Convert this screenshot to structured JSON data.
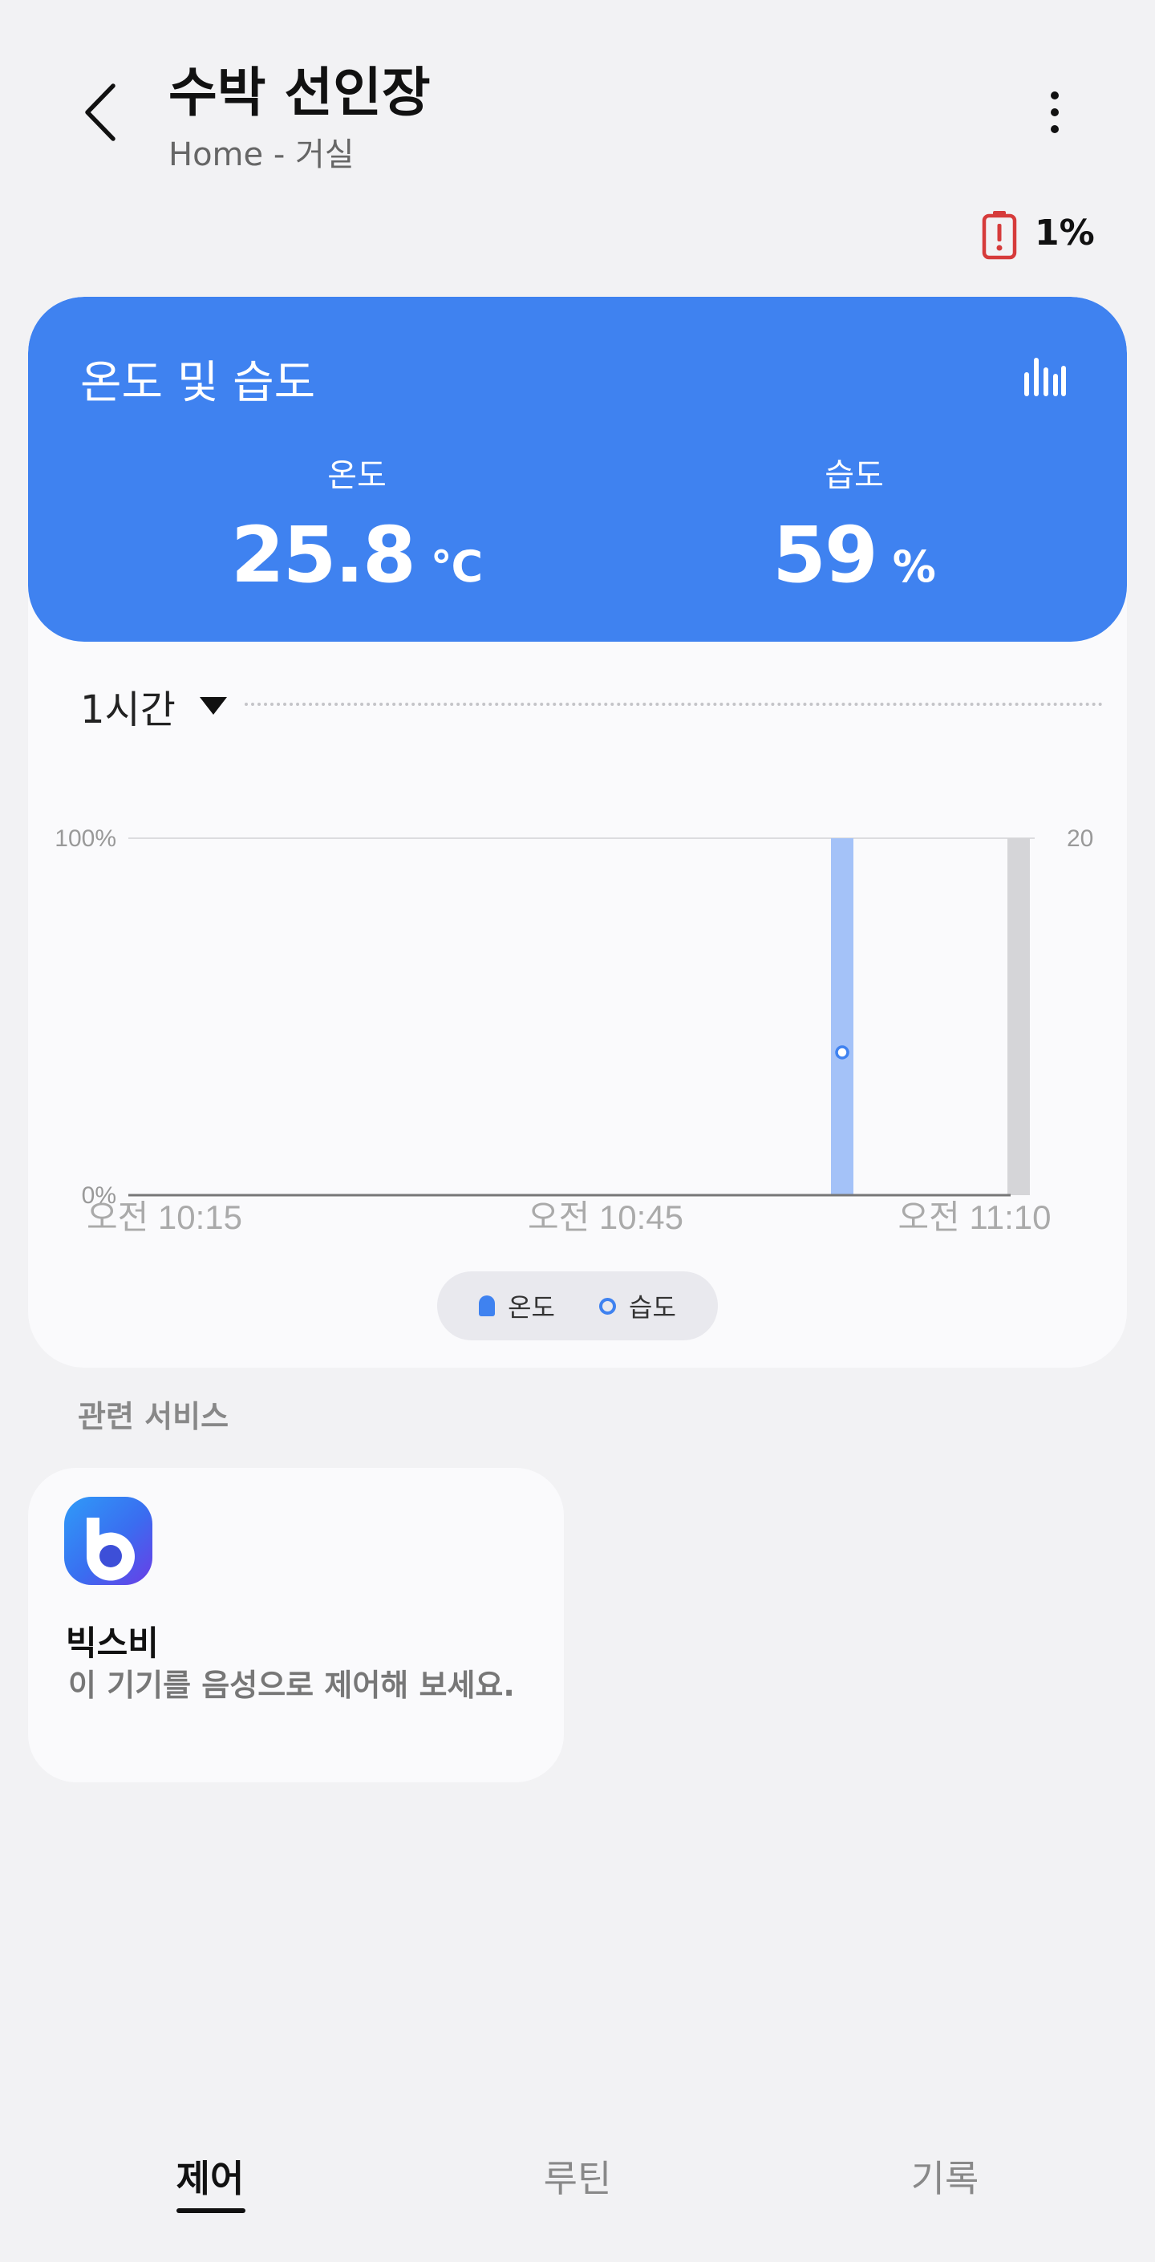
{
  "header": {
    "title": "수박 선인장",
    "subtitle": "Home - 거실",
    "battery": "1%"
  },
  "card": {
    "title": "온도 및 습도",
    "temperature": {
      "label": "온도",
      "value": "25.8",
      "unit": "℃"
    },
    "humidity": {
      "label": "습도",
      "value": "59",
      "unit": "%"
    },
    "range": "1시간"
  },
  "chart_data": {
    "type": "bar",
    "x_ticks": [
      "오전 10:15",
      "오전 10:45",
      "오전 11:10"
    ],
    "left_axis": {
      "ticks": [
        "0%",
        "100%"
      ]
    },
    "right_axis": {
      "ticks": [
        "20"
      ]
    },
    "series": [
      {
        "name": "온도",
        "color": "#3f82f0",
        "points": [
          {
            "x": "10:57",
            "y": 100
          },
          {
            "x": "11:08",
            "y": 100,
            "color": "#d5d5d8"
          }
        ]
      },
      {
        "name": "습도",
        "color": "#3f82f0",
        "points": [
          {
            "x": "10:57",
            "y": 40
          }
        ]
      }
    ],
    "legend": [
      "온도",
      "습도"
    ],
    "legend_position": "bottom"
  },
  "related": {
    "title": "관련 서비스",
    "bixby": {
      "name": "빅스비",
      "description": "이 기기를 음성으로 제어해 보세요."
    }
  },
  "nav": {
    "tabs": [
      "제어",
      "루틴",
      "기록"
    ],
    "active": "제어"
  }
}
